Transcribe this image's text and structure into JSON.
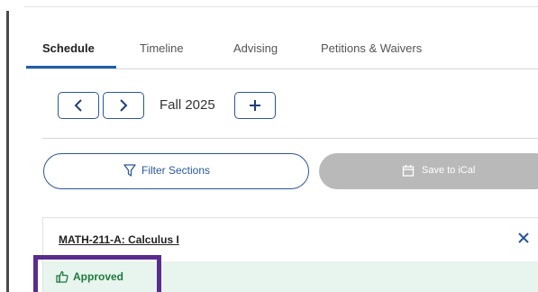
{
  "tabs": [
    {
      "label": "Schedule",
      "active": true
    },
    {
      "label": "Timeline",
      "active": false
    },
    {
      "label": "Advising",
      "active": false
    },
    {
      "label": "Petitions & Waivers",
      "active": false
    }
  ],
  "term_nav": {
    "term": "Fall 2025",
    "prev_icon": "chevron-left-icon",
    "next_icon": "chevron-right-icon",
    "add_icon": "plus-icon"
  },
  "actions": {
    "filter_label": "Filter Sections",
    "filter_icon": "funnel-icon",
    "ical_label": "Save to iCal",
    "ical_icon": "calendar-icon"
  },
  "course": {
    "title": "MATH-211-A: Calculus I",
    "status": "Approved",
    "status_icon": "thumbs-up-icon",
    "close_icon": "close-icon"
  },
  "colors": {
    "accent": "#2b5797",
    "approved_text": "#1d7a3c",
    "approved_bg": "#e8f4ee",
    "highlight": "#5b2c8f",
    "disabled_button": "#b9b9b9"
  }
}
